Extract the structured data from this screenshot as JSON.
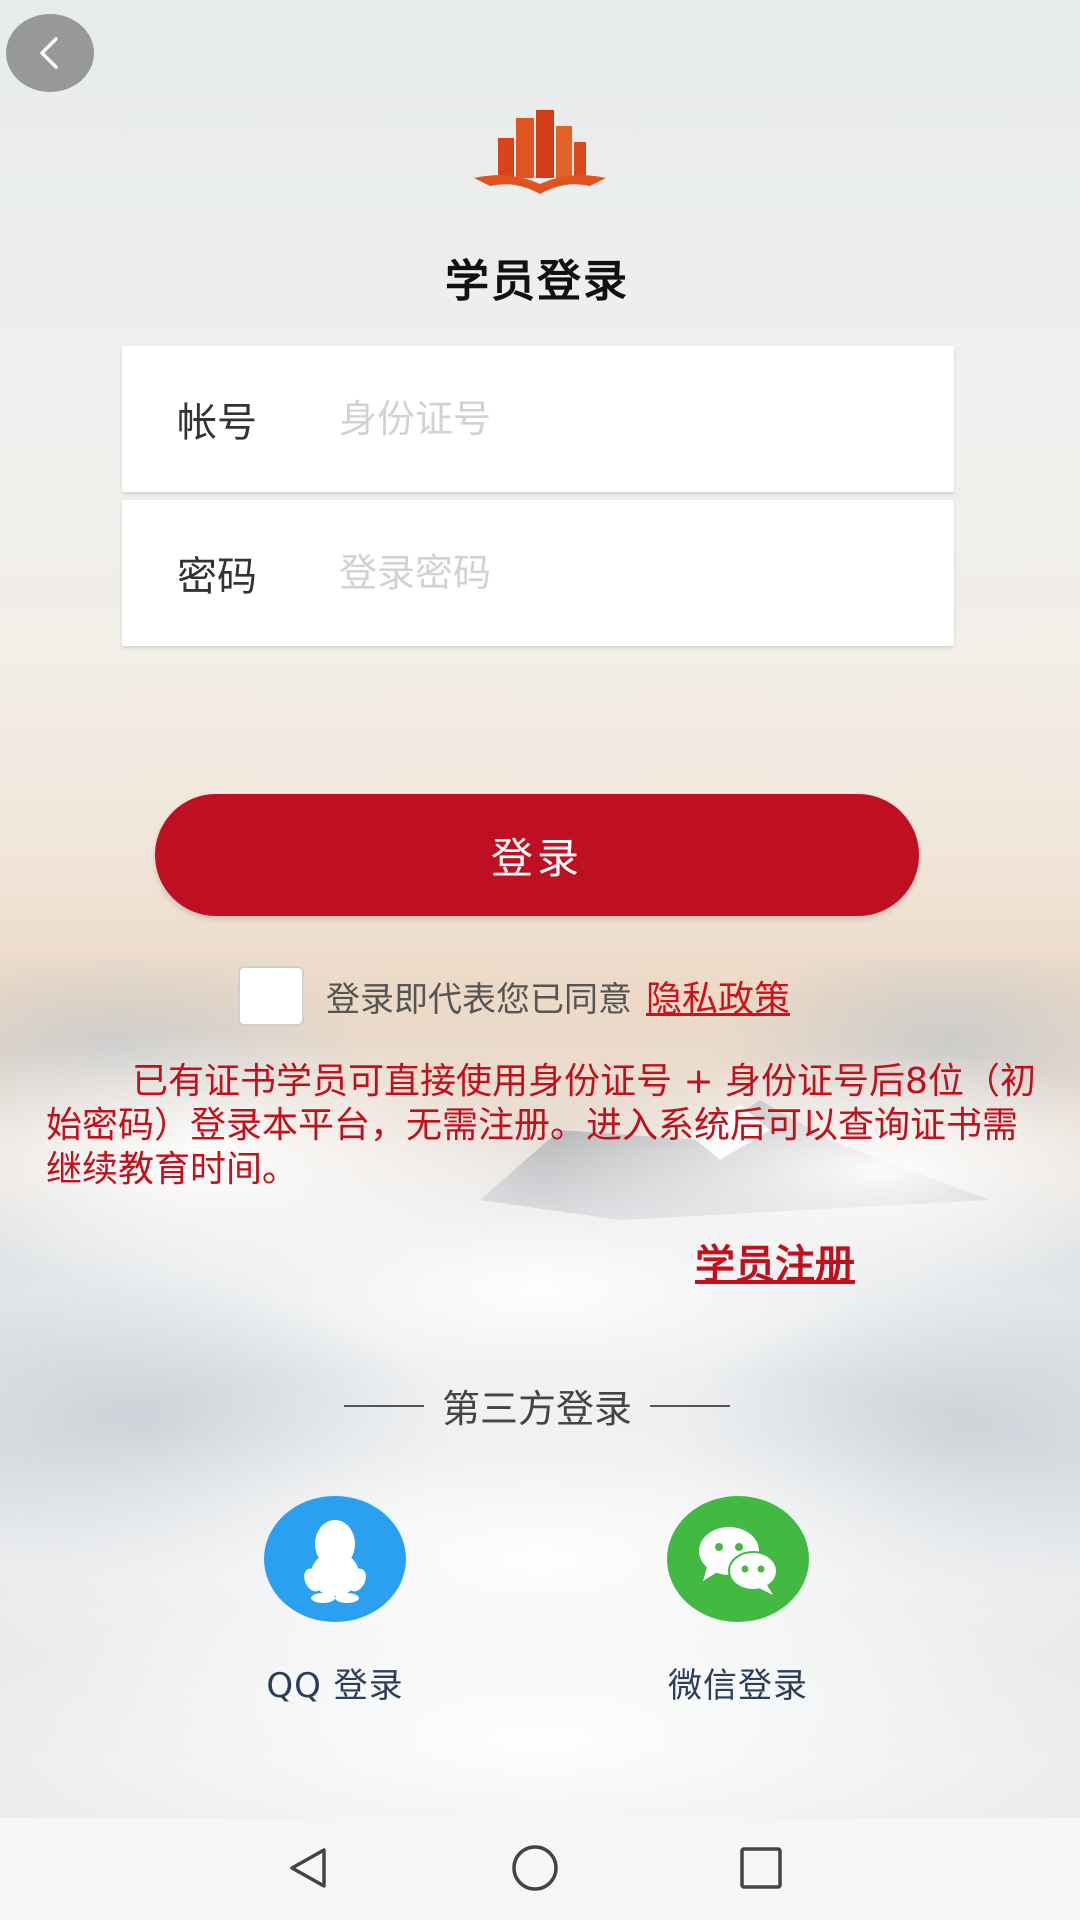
{
  "header": {
    "title": "学员登录",
    "back_icon": "chevron-left-icon",
    "logo_icon": "building-book-logo"
  },
  "form": {
    "account_label": "帐号",
    "account_placeholder": "身份证号",
    "password_label": "密码",
    "password_placeholder": "登录密码",
    "login_button": "登录"
  },
  "agreement": {
    "checked": false,
    "text": "登录即代表您已同意",
    "privacy_link": "隐私政策"
  },
  "notice": "已有证书学员可直接使用身份证号 + 身份证号后8位（初始密码）登录本平台，无需注册。进入系统后可以查询证书需继续教育时间。",
  "register_link": "学员注册",
  "third_party": {
    "title": "第三方登录",
    "qq_label": "QQ 登录",
    "wechat_label": "微信登录"
  },
  "nav_bar": {
    "back_icon": "triangle-back-icon",
    "home_icon": "circle-home-icon",
    "recent_icon": "square-recents-icon"
  },
  "colors": {
    "primary": "#be0f23",
    "link": "#c0101c",
    "qq": "#2b9ff0",
    "wechat": "#43b944"
  }
}
